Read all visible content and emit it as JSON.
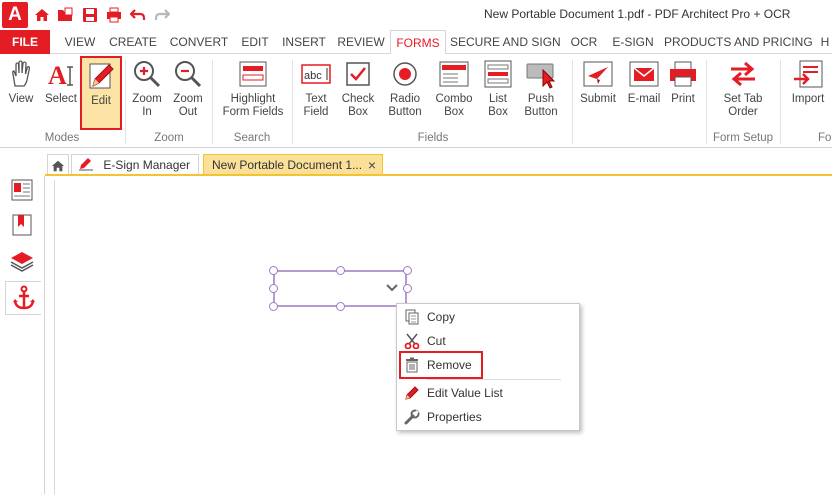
{
  "app": {
    "logo_letter": "A",
    "title": "New Portable Document 1.pdf   -   PDF Architect Pro + OCR"
  },
  "quick_access": [
    "home-icon",
    "open-folder-icon",
    "save-icon",
    "print-icon",
    "undo-icon",
    "redo-icon"
  ],
  "menu": {
    "tabs": [
      "FILE",
      "VIEW",
      "CREATE",
      "CONVERT",
      "EDIT",
      "INSERT",
      "REVIEW",
      "FORMS",
      "SECURE AND SIGN",
      "OCR",
      "E-SIGN",
      "PRODUCTS AND PRICING",
      "H"
    ],
    "active": "FORMS"
  },
  "ribbon": {
    "buttons": [
      {
        "label": "View"
      },
      {
        "label": "Select"
      },
      {
        "label": "Edit"
      },
      {
        "label": "Zoom\nIn"
      },
      {
        "label": "Zoom\nOut"
      },
      {
        "label": "Highlight\nForm Fields"
      },
      {
        "label": "Text\nField"
      },
      {
        "label": "Check\nBox"
      },
      {
        "label": "Radio\nButton"
      },
      {
        "label": "Combo\nBox"
      },
      {
        "label": "List\nBox"
      },
      {
        "label": "Push\nButton"
      },
      {
        "label": "Submit"
      },
      {
        "label": "E-mail"
      },
      {
        "label": "Print"
      },
      {
        "label": "Set Tab\nOrder"
      },
      {
        "label": "Import"
      }
    ],
    "groups": [
      "Modes",
      "Zoom",
      "Search",
      "Fields",
      "Form Setup",
      "Fo"
    ],
    "selected_button": "Edit"
  },
  "doc_tabs": {
    "tabs": [
      {
        "label": "E-Sign Manager"
      },
      {
        "label": "New Portable Document 1...",
        "close": "×"
      }
    ]
  },
  "side_panel": {
    "toggle": ">",
    "items": [
      "pages-icon",
      "bookmarks-icon",
      "layers-icon",
      "anchor-icon"
    ]
  },
  "context_menu": {
    "items": [
      {
        "label": "Copy",
        "icon": "copy-icon"
      },
      {
        "label": "Cut",
        "icon": "scissors-icon"
      },
      {
        "label": "Remove",
        "icon": "trash-icon"
      },
      {
        "label": "Edit Value List",
        "icon": "pencil-icon"
      },
      {
        "label": "Properties",
        "icon": "wrench-icon"
      }
    ],
    "highlighted": "Remove"
  },
  "colors": {
    "accent": "#e41c23",
    "selected_fill": "#fce4a6",
    "tab_underline": "#f4c430",
    "field_border": "#b79ad3"
  }
}
